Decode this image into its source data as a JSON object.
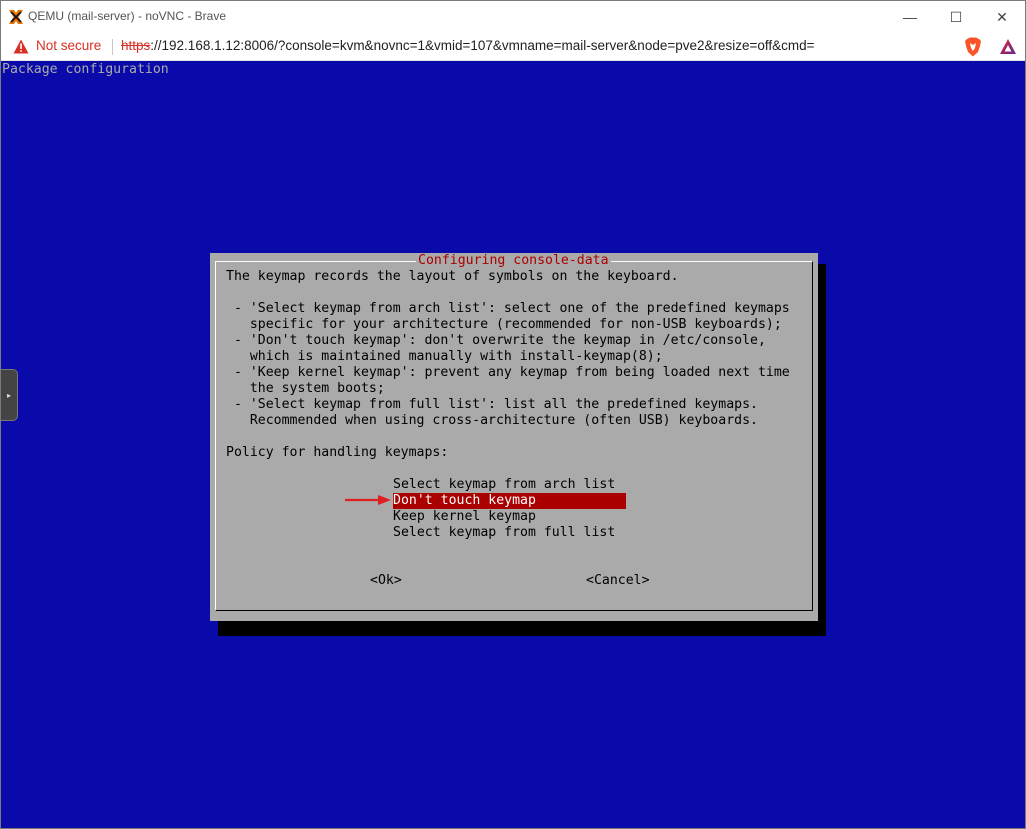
{
  "window": {
    "title": "QEMU (mail-server) - noVNC - Brave",
    "controls": {
      "minimize": "—",
      "maximize": "☐",
      "close": "✕"
    }
  },
  "addressbar": {
    "security_text": "Not secure",
    "url_scheme": "https",
    "url_rest": "://192.168.1.12:8006/?console=kvm&novnc=1&vmid=107&vmname=mail-server&node=pve2&resize=off&cmd="
  },
  "console": {
    "header": "Package configuration",
    "side_handle_glyph": "▸",
    "dialog": {
      "title": "Configuring console-data",
      "body": "The keymap records the layout of symbols on the keyboard.\n\n - 'Select keymap from arch list': select one of the predefined keymaps\n   specific for your architecture (recommended for non-USB keyboards);\n - 'Don't touch keymap': don't overwrite the keymap in /etc/console,\n   which is maintained manually with install-keymap(8);\n - 'Keep kernel keymap': prevent any keymap from being loaded next time\n   the system boots;\n - 'Select keymap from full list': list all the predefined keymaps.\n   Recommended when using cross-architecture (often USB) keyboards.\n\nPolicy for handling keymaps:",
      "options": [
        "Select keymap from arch list",
        "Don't touch keymap",
        "Keep kernel keymap",
        "Select keymap from full list"
      ],
      "selected_index": 1,
      "ok_label": "<Ok>",
      "cancel_label": "<Cancel>"
    }
  },
  "colors": {
    "console_bg": "#0a0aaa",
    "dialog_bg": "#aaaaaa",
    "selection": "#aa0000",
    "annotation_arrow": "#e02020"
  }
}
